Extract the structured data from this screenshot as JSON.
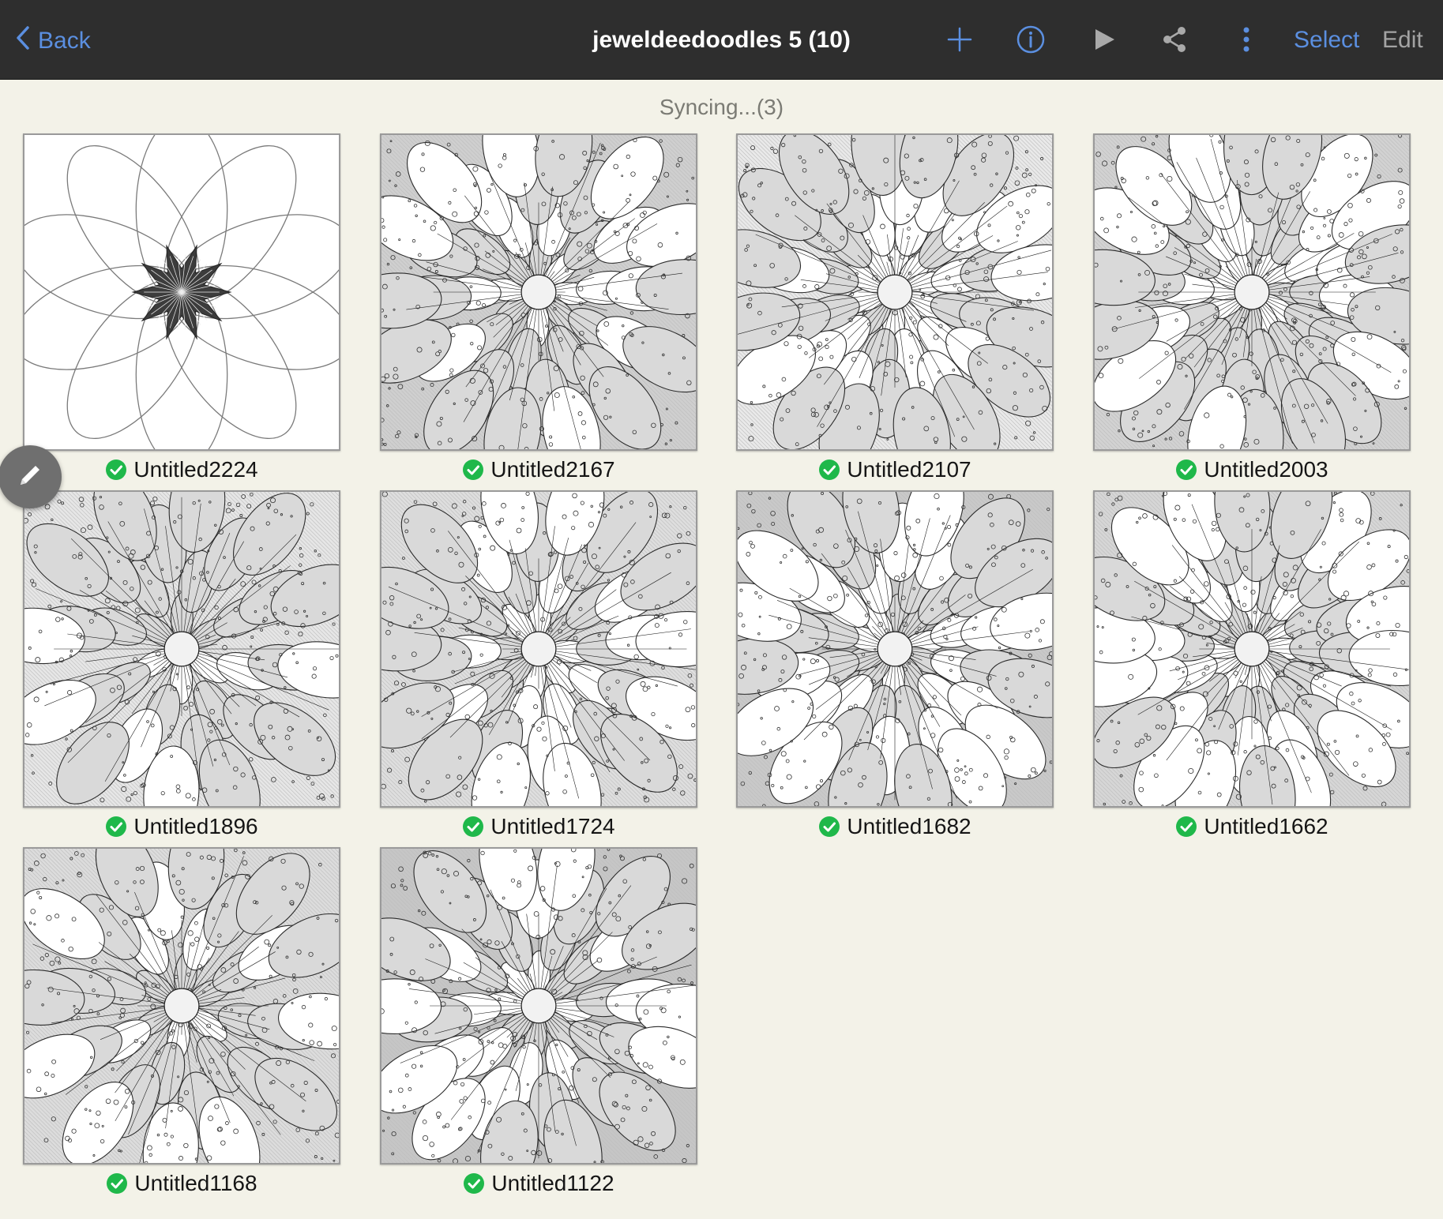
{
  "header": {
    "back_label": "Back",
    "title": "jeweldeedoodles 5 (10)",
    "add_icon": "plus-icon",
    "info_icon": "info-icon",
    "play_icon": "play-icon",
    "share_icon": "share-icon",
    "more_icon": "more-vertical-icon",
    "select_label": "Select",
    "edit_label": "Edit",
    "accent_color": "#5b8fe0"
  },
  "status": {
    "sync_text": "Syncing...(3)"
  },
  "gallery": {
    "items": [
      {
        "label": "Untitled2224",
        "synced": true
      },
      {
        "label": "Untitled2167",
        "synced": true
      },
      {
        "label": "Untitled2107",
        "synced": true
      },
      {
        "label": "Untitled2003",
        "synced": true
      },
      {
        "label": "Untitled1896",
        "synced": true
      },
      {
        "label": "Untitled1724",
        "synced": true
      },
      {
        "label": "Untitled1682",
        "synced": true
      },
      {
        "label": "Untitled1662",
        "synced": true
      },
      {
        "label": "Untitled1168",
        "synced": true
      },
      {
        "label": "Untitled1122",
        "synced": true
      }
    ],
    "synced_color": "#1fb84a"
  },
  "fab": {
    "icon": "pencil-icon"
  }
}
